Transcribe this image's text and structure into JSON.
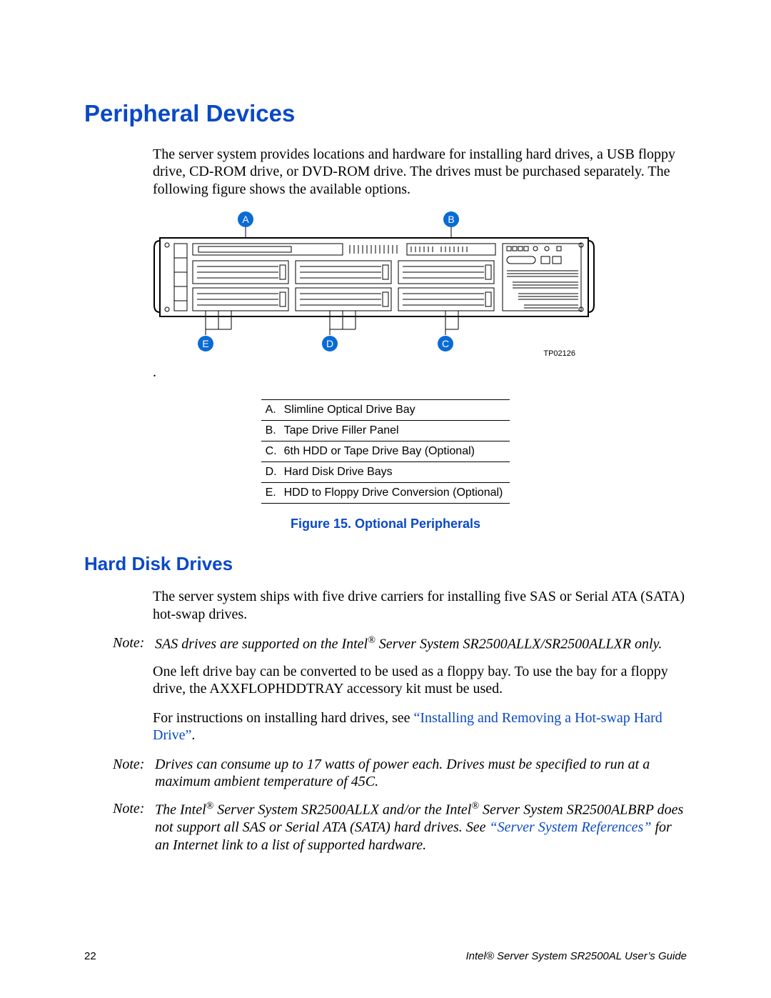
{
  "heading1": "Peripheral Devices",
  "intro_para": "The server system provides locations and hardware for installing hard drives, a USB floppy drive, CD-ROM drive, or DVD-ROM drive. The drives must be purchased separately. The following figure shows the available options.",
  "diagram": {
    "callouts": [
      "A",
      "B",
      "C",
      "D",
      "E"
    ],
    "id": "TP02126"
  },
  "legend": [
    {
      "k": "A.",
      "v": "Slimline Optical Drive Bay"
    },
    {
      "k": "B.",
      "v": "Tape Drive Filler Panel"
    },
    {
      "k": "C.",
      "v": "6th HDD or Tape Drive Bay (Optional)"
    },
    {
      "k": "D.",
      "v": "Hard Disk Drive Bays"
    },
    {
      "k": "E.",
      "v": "HDD to Floppy Drive Conversion (Optional)"
    }
  ],
  "figure_caption": "Figure 15. Optional Peripherals",
  "heading2": "Hard Disk Drives",
  "hdd_intro": "The server system ships with five drive carriers for installing five SAS or Serial ATA (SATA) hot-swap drives.",
  "note1_label": "Note:",
  "note1_body_a": "SAS drives are supported on the Intel",
  "note1_body_b": " Server System SR2500ALLX/SR2500ALLXR only.",
  "hdd_p2": "One left drive bay can be converted to be used as a floppy bay. To use the bay for a floppy drive, the AXXFLOPHDDTRAY accessory kit must be used.",
  "hdd_p3_a": "For instructions on installing hard drives, see ",
  "hdd_p3_link": "“Installing and Removing a Hot-swap Hard Drive”",
  "hdd_p3_b": ".",
  "note2_label": "Note:",
  "note2_body": "Drives can consume up to 17 watts of power each. Drives must be specified to run at a maximum ambient temperature of 45C.",
  "note3_label": "Note:",
  "note3_a": "The Intel",
  "note3_b": " Server System SR2500ALLX and/or the Intel",
  "note3_c": " Server System SR2500ALBRP does not support all SAS or Serial ATA (SATA) hard drives. See ",
  "note3_link": "“Server System References”",
  "note3_d": " for an Internet link to a list of supported hardware.",
  "page_number": "22",
  "footer_title": "Intel® Server System SR2500AL User’s Guide",
  "reg_mark": "®"
}
